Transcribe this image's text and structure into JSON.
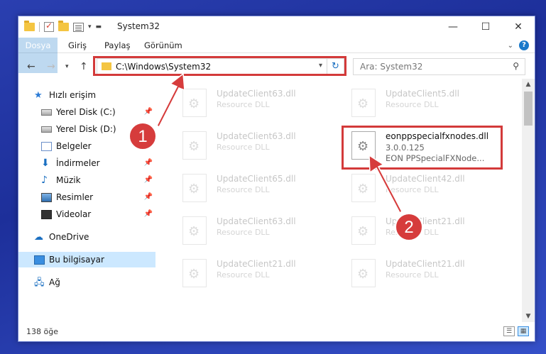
{
  "window": {
    "title": "System32",
    "controls": {
      "minimize": "—",
      "maximize": "☐",
      "close": "✕"
    }
  },
  "ribbon": {
    "tabs": [
      "Dosya",
      "Giriş",
      "Paylaş",
      "Görünüm"
    ]
  },
  "address": {
    "path": "C:\\Windows\\System32",
    "search_placeholder": "Ara: System32"
  },
  "sidebar": {
    "items": [
      {
        "label": "Hızlı erişim",
        "icon": "star-icon",
        "pinned": false
      },
      {
        "label": "Yerel Disk (C:)",
        "icon": "drive-icon",
        "pinned": true
      },
      {
        "label": "Yerel Disk (D:)",
        "icon": "drive-icon",
        "pinned": true
      },
      {
        "label": "Belgeler",
        "icon": "documents-icon",
        "pinned": true
      },
      {
        "label": "İndirmeler",
        "icon": "download-icon",
        "pinned": true
      },
      {
        "label": "Müzik",
        "icon": "music-icon",
        "pinned": true
      },
      {
        "label": "Resimler",
        "icon": "pictures-icon",
        "pinned": true
      },
      {
        "label": "Videolar",
        "icon": "videos-icon",
        "pinned": true
      },
      {
        "label": "OneDrive",
        "icon": "cloud-icon",
        "pinned": false
      },
      {
        "label": "Bu bilgisayar",
        "icon": "computer-icon",
        "pinned": false,
        "selected": true
      },
      {
        "label": "Ağ",
        "icon": "network-icon",
        "pinned": false
      }
    ]
  },
  "files": [
    {
      "name": "UpdateClient63.dll",
      "type": "Resource DLL"
    },
    {
      "name": "UpdateClient5.dll",
      "type": "Resource DLL"
    },
    {
      "name": "UpdateClient63.dll",
      "type": "Resource DLL"
    },
    {
      "name": "eonppspecialfxnodes.dll",
      "version": "3.0.0.125",
      "description": "EON PPSpecialFXNode...",
      "highlighted": true
    },
    {
      "name": "UpdateClient65.dll",
      "type": "Resource DLL"
    },
    {
      "name": "UpdateClient42.dll",
      "type": "Resource DLL"
    },
    {
      "name": "UpdateClient63.dll",
      "type": "Resource DLL"
    },
    {
      "name": "UpdateClient21.dll",
      "type": "Resource DLL"
    },
    {
      "name": "UpdateClient21.dll",
      "type": "Resource DLL"
    },
    {
      "name": "UpdateClient21.dll",
      "type": "Resource DLL"
    }
  ],
  "status": {
    "item_count": "138 öğe"
  },
  "annotations": {
    "step1": "1",
    "step2": "2",
    "accent": "#d63c3c"
  }
}
